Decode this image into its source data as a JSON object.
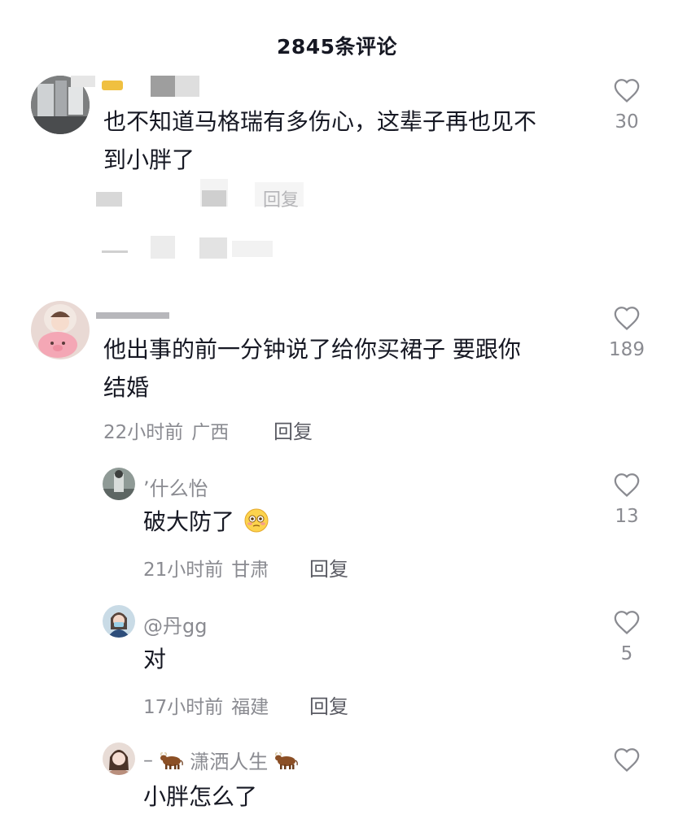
{
  "header": {
    "title": "2845条评论"
  },
  "comments": [
    {
      "text_line1": "也不知道马格瑞有多伤心，这辈子再也见不",
      "text_line2": "到小胖了",
      "like_count": "30",
      "collapsed_reply_label": "回复"
    },
    {
      "text_line1": "他出事的前一分钟说了给你买裙子 要跟你",
      "text_line2": "结婚",
      "time": "22小时前",
      "location": "广西",
      "reply_label": "回复",
      "like_count": "189",
      "replies": [
        {
          "name": "’什么怡",
          "text": "破大防了",
          "time": "21小时前",
          "location": "甘肃",
          "reply_label": "回复",
          "like_count": "13"
        },
        {
          "name": "@丹gg",
          "text": "对",
          "time": "17小时前",
          "location": "福建",
          "reply_label": "回复",
          "like_count": "5"
        },
        {
          "name": "潇洒人生",
          "text": "小胖怎么了"
        }
      ]
    }
  ],
  "colors": {
    "primary_text": "#161823",
    "secondary_text": "#8a8b91",
    "reply_text": "#5a5b63"
  }
}
